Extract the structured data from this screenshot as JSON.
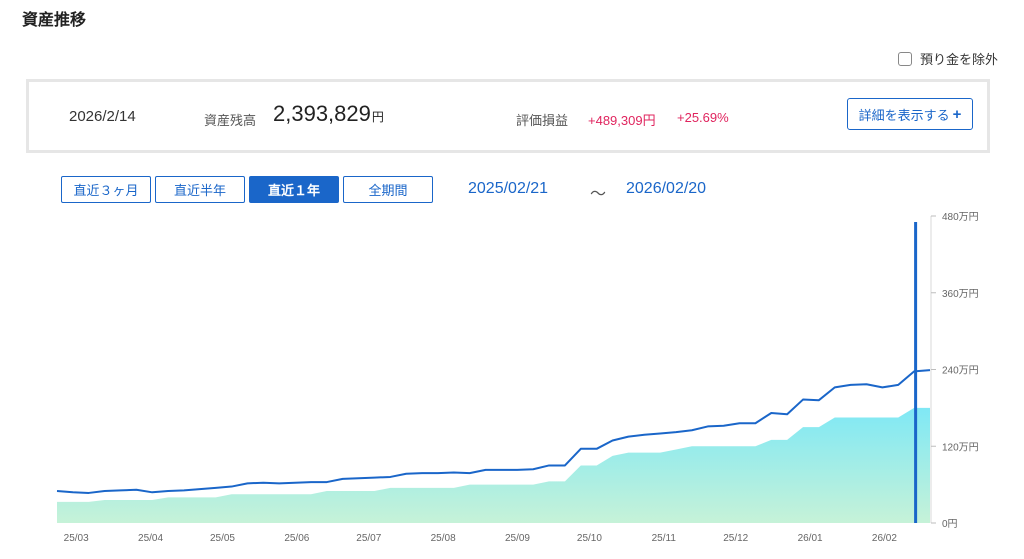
{
  "title": "資産推移",
  "exclude_deposits": {
    "label": "預り金を除外",
    "checked": false
  },
  "summary": {
    "date": "2026/2/14",
    "balance_label": "資産残高",
    "balance_value": "2,393,829",
    "balance_unit": "円",
    "pl_label": "評価損益",
    "pl_amount": "+489,309円",
    "pl_percent": "+25.69%",
    "details_label": "詳細を表示する",
    "details_icon": "+"
  },
  "periods": [
    {
      "label": "直近３ヶ月",
      "active": false
    },
    {
      "label": "直近半年",
      "active": false
    },
    {
      "label": "直近１年",
      "active": true
    },
    {
      "label": "全期間",
      "active": false
    }
  ],
  "range": {
    "start": "2025/02/21",
    "sep": "～",
    "end": "2026/02/20"
  },
  "colors": {
    "accent": "#1a66c9",
    "line": "#1a66c9",
    "area_top": "#7fe8f5",
    "area_bottom": "#c6f2d8",
    "positive": "#e0245e"
  },
  "chart_data": {
    "type": "area",
    "ylim": [
      0,
      4800000
    ],
    "y_ticks": [
      {
        "value": 4800000,
        "label": "480万円"
      },
      {
        "value": 3600000,
        "label": "360万円"
      },
      {
        "value": 2400000,
        "label": "240万円"
      },
      {
        "value": 1200000,
        "label": "120万円"
      },
      {
        "value": 0,
        "label": "0円"
      }
    ],
    "x_labels": [
      "25/03",
      "25/04",
      "25/05",
      "25/06",
      "25/07",
      "25/08",
      "25/09",
      "25/10",
      "25/11",
      "25/12",
      "26/01",
      "26/02"
    ],
    "x": [
      "2025-02-21",
      "2025-02-28",
      "2025-03-07",
      "2025-03-14",
      "2025-03-21",
      "2025-03-28",
      "2025-04-04",
      "2025-04-11",
      "2025-04-18",
      "2025-04-25",
      "2025-05-02",
      "2025-05-09",
      "2025-05-16",
      "2025-05-23",
      "2025-05-30",
      "2025-06-06",
      "2025-06-13",
      "2025-06-20",
      "2025-06-27",
      "2025-07-04",
      "2025-07-11",
      "2025-07-18",
      "2025-07-25",
      "2025-08-01",
      "2025-08-08",
      "2025-08-15",
      "2025-08-22",
      "2025-08-29",
      "2025-09-05",
      "2025-09-12",
      "2025-09-19",
      "2025-09-26",
      "2025-10-03",
      "2025-10-10",
      "2025-10-17",
      "2025-10-24",
      "2025-10-31",
      "2025-11-07",
      "2025-11-14",
      "2025-11-21",
      "2025-11-28",
      "2025-12-05",
      "2025-12-12",
      "2025-12-19",
      "2025-12-26",
      "2026-01-02",
      "2026-01-09",
      "2026-01-16",
      "2026-01-23",
      "2026-01-30",
      "2026-02-06",
      "2026-02-13",
      "2026-02-20"
    ],
    "series": [
      {
        "type": "line",
        "values": [
          500000,
          480000,
          470000,
          500000,
          510000,
          520000,
          480000,
          500000,
          510000,
          530000,
          550000,
          570000,
          620000,
          630000,
          620000,
          630000,
          640000,
          640000,
          690000,
          700000,
          710000,
          720000,
          770000,
          780000,
          780000,
          790000,
          780000,
          830000,
          830000,
          830000,
          840000,
          900000,
          900000,
          1160000,
          1160000,
          1290000,
          1350000,
          1380000,
          1400000,
          1420000,
          1450000,
          1510000,
          1520000,
          1560000,
          1560000,
          1720000,
          1700000,
          1930000,
          1920000,
          2120000,
          2160000,
          2170000,
          2120000,
          2160000,
          2370000,
          2390000
        ]
      },
      {
        "type": "area",
        "values": [
          330000,
          330000,
          330000,
          360000,
          360000,
          360000,
          360000,
          400000,
          400000,
          400000,
          400000,
          450000,
          450000,
          450000,
          450000,
          450000,
          450000,
          500000,
          500000,
          500000,
          500000,
          550000,
          550000,
          550000,
          550000,
          550000,
          600000,
          600000,
          600000,
          600000,
          600000,
          650000,
          650000,
          900000,
          900000,
          1050000,
          1100000,
          1100000,
          1100000,
          1150000,
          1200000,
          1200000,
          1200000,
          1200000,
          1200000,
          1300000,
          1300000,
          1500000,
          1500000,
          1650000,
          1650000,
          1650000,
          1650000,
          1650000,
          1800000,
          1800000
        ]
      }
    ],
    "marker": "2026-02-14"
  }
}
